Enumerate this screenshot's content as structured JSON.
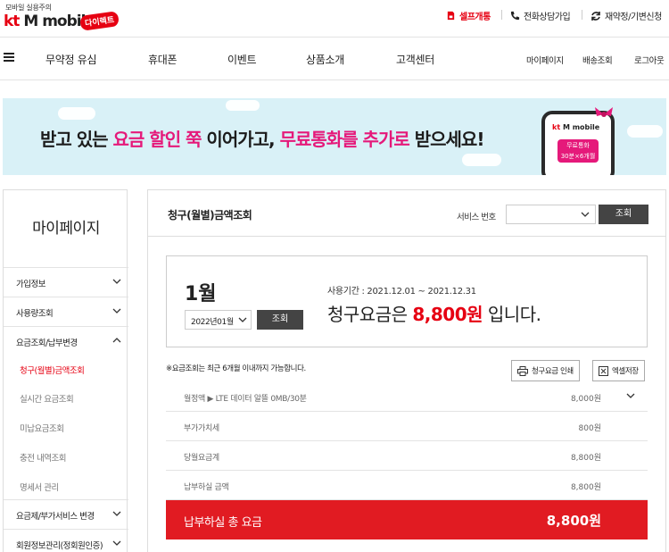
{
  "header": {
    "tagline": "모바일 실용주의",
    "logo_kt": "kt",
    "logo_rest": "M mobile",
    "logo_badge": "다이렉트",
    "util": {
      "self_open": "셀프개통",
      "consult": "전화상담가입",
      "renew": "재약정/기변신청"
    }
  },
  "nav": {
    "items": [
      "무약정 유심",
      "휴대폰",
      "이벤트",
      "상품소개",
      "고객센터"
    ],
    "right": [
      "마이페이지",
      "배송조회",
      "로그아웃"
    ]
  },
  "banner": {
    "text_1": "받고 있는 ",
    "text_hl_1": "요금 할인 쭉",
    "text_2": " 이어가고, ",
    "text_hl_2": "무료통화를 추가로",
    "text_3": " 받으세요!",
    "phone_logo_kt": "kt",
    "phone_logo_rest": " M mobile",
    "phone_badge_line1": "무료통화",
    "phone_badge_line2": "30분×6개월"
  },
  "sidebar": {
    "title": "마이페이지",
    "sections": [
      {
        "label": "가입정보",
        "expanded": false
      },
      {
        "label": "사용량조회",
        "expanded": false
      },
      {
        "label": "요금조회/납부변경",
        "expanded": true
      },
      {
        "label": "요금제/부가서비스 변경",
        "expanded": false
      },
      {
        "label": "회원정보관리(정회원인증)",
        "expanded": false
      }
    ],
    "sub_items": [
      "청구(월별)금액조회",
      "실시간 요금조회",
      "미납요금조회",
      "충전 내역조회",
      "명세서 관리"
    ],
    "active_sub": "청구(월별)금액조회"
  },
  "main": {
    "title": "청구(월별)금액조회",
    "service_label": "서비스 번호",
    "service_value": "",
    "query_button": "조회",
    "month": "1월",
    "month_select": "2022년01월",
    "period": "사용기간 : 2021.12.01 ~ 2021.12.31",
    "amount_prefix": "청구요금은 ",
    "amount": "8,800원",
    "amount_suffix": " 입니다.",
    "note": "※요금조회는 최근 6개월 이내까지 가능합니다.",
    "print_button": "청구요금 인쇄",
    "excel_button": "엑셀저장",
    "rows": [
      {
        "label": "월정액 ▶ LTE 데이터 알뜰 0MB/30분",
        "value": "8,000원"
      },
      {
        "label": "부가가치세",
        "value": "800원"
      },
      {
        "label": "당월요금계",
        "value": "8,800원"
      },
      {
        "label": "납부하실 금액",
        "value": "8,800원"
      }
    ],
    "total_label": "납부하실 총 요금",
    "total_value": "8,800원"
  },
  "colors": {
    "brand_red": "#e60012",
    "banner_pink": "#e5197a",
    "banner_bg": "#d9f1f7",
    "total_bar": "#e11b22"
  }
}
